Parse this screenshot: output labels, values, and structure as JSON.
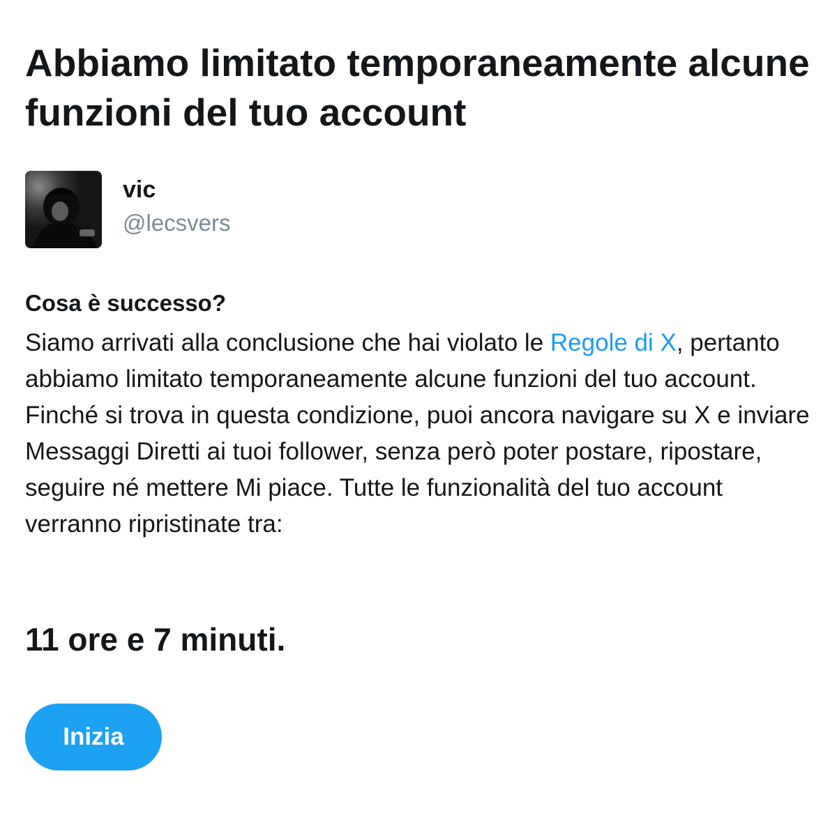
{
  "title": "Abbiamo limitato temporaneamente alcune funzioni del tuo account",
  "account": {
    "display_name": "vic",
    "handle": "@lecsvers"
  },
  "section": {
    "heading": "Cosa è successo?",
    "body_before_link": "Siamo arrivati alla conclusione che hai violato le ",
    "link_text": "Regole di X",
    "body_after_link": ", pertanto abbiamo limitato temporaneamente alcune funzioni del tuo account. Finché si trova in questa condizione, puoi ancora navigare su X e inviare Messaggi Diretti ai tuoi follower, senza però poter postare, ripostare, seguire né mettere Mi piace. Tutte le funzionalità del tuo account verranno ripristinate tra:"
  },
  "countdown": "11 ore e 7 minuti.",
  "start_button_label": "Inizia",
  "colors": {
    "link": "#1d9bf0",
    "button": "#1da1f2",
    "text": "#14171a",
    "muted": "#7a8a99"
  }
}
